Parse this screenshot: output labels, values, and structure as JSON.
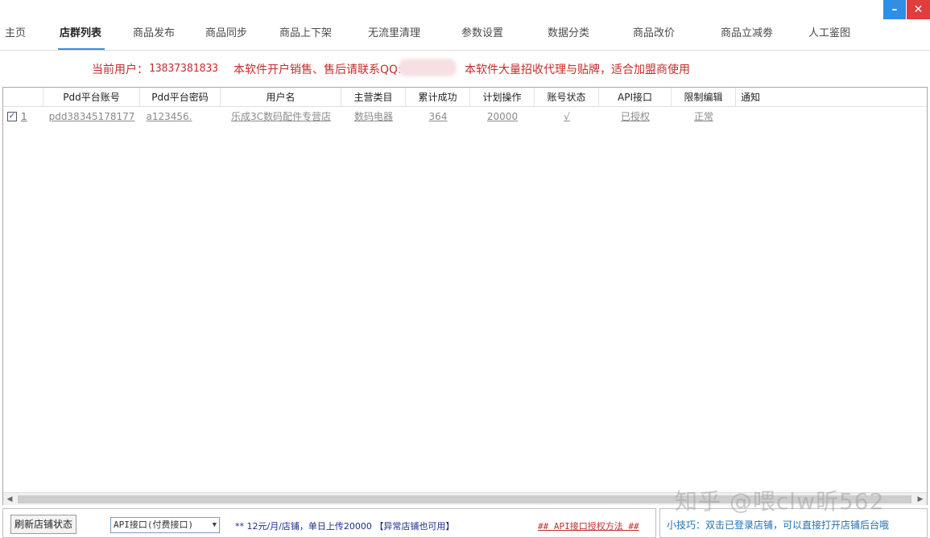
{
  "window": {
    "minimize_glyph": "–",
    "close_glyph": "✕"
  },
  "tabs": [
    {
      "label": "主页"
    },
    {
      "label": "店群列表"
    },
    {
      "label": "商品发布"
    },
    {
      "label": "商品同步"
    },
    {
      "label": "商品上下架"
    },
    {
      "label": "无流里清理"
    },
    {
      "label": "参数设置"
    },
    {
      "label": "数据分类"
    },
    {
      "label": "商品改价"
    },
    {
      "label": "商品立减劵"
    },
    {
      "label": "人工鉴图"
    }
  ],
  "active_tab": "店群列表",
  "notice": {
    "current_user_label": "当前用户：",
    "current_user_value": "13837381833",
    "sales_contact": "本软件开户销售、售后请联系QQ:",
    "agent_recruit": "本软件大量招收代理与贴牌，适合加盟商使用"
  },
  "table": {
    "columns": [
      "Pdd平台账号",
      "Pdd平台密码",
      "用户名",
      "主营类目",
      "累计成功",
      "计划操作",
      "账号状态",
      "API接口",
      "限制编辑",
      "通知"
    ],
    "rows": [
      {
        "checked": "✓",
        "index": "1",
        "account": "pdd38345178177",
        "password": "a123456.",
        "username": "乐成3C数码配件专营店",
        "category": "数码电器",
        "total_success": "364",
        "planned_ops": "20000",
        "account_status": "√",
        "api": "已授权",
        "edit_limit": "正常",
        "notify": ""
      }
    ]
  },
  "scrollbar": {
    "left_arrow": "◀",
    "right_arrow": "▶"
  },
  "bottom": {
    "refresh_button": "刷新店铺状态",
    "api_select_value": "API接口(付费接口)",
    "api_select_arrow": "▼",
    "price_note": "** 12元/月/店铺，单日上传20000 【异常店铺也可用】",
    "auth_link": "## API接口授权方法 ##",
    "tip": "小技巧：双击已登录店铺，可以直接打开店铺后台哦"
  },
  "watermark": "知乎 @喂clw昕562",
  "colors": {
    "accent": "#2f8ee5",
    "notice_red": "#c62b2b",
    "tip_blue": "#1c6fb5"
  }
}
